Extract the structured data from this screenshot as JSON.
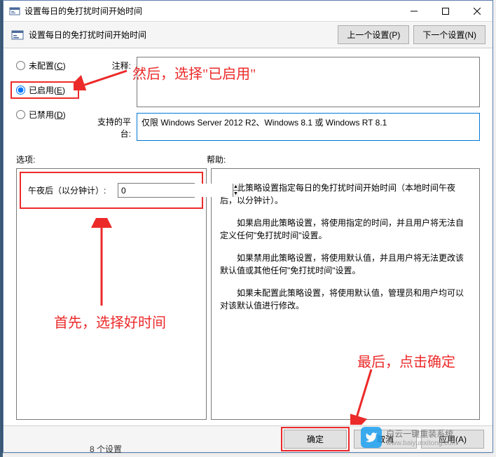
{
  "window": {
    "title": "设置每日的免打扰时间开始时间"
  },
  "toolbar": {
    "title": "设置每日的免打扰时间开始时间",
    "prev_button": "上一个设置(P)",
    "next_button": "下一个设置(N)"
  },
  "radios": {
    "not_configured": "未配置(C)",
    "enabled": "已启用(E)",
    "disabled": "已禁用(D)"
  },
  "fields": {
    "comment_label": "注释:",
    "comment_value": "",
    "platform_label": "支持的平台:",
    "platform_value": "仅限 Windows Server 2012 R2、Windows 8.1 或 Windows RT 8.1"
  },
  "section_labels": {
    "options": "选项:",
    "help": "帮助:"
  },
  "options": {
    "midnight_label": "午夜后（以分钟计）:",
    "midnight_value": "0"
  },
  "help": {
    "p1": "此策略设置指定每日的免打扰时间开始时间（本地时间午夜后，以分钟计）。",
    "p2": "如果启用此策略设置，将使用指定的时间，并且用户将无法自定义任何\"免打扰时间\"设置。",
    "p3": "如果禁用此策略设置，将使用默认值，并且用户将无法更改该默认值或其他任何\"免打扰时间\"设置。",
    "p4": "如果未配置此策略设置，将使用默认值，管理员和用户均可以对该默认值进行修改。"
  },
  "buttons": {
    "ok": "确定",
    "cancel": "取消",
    "apply": "应用(A)"
  },
  "annotations": {
    "a1": "然后，选择\"已启用\"",
    "a2": "首先，选择好时间",
    "a3": "最后，点击确定"
  },
  "watermark": "白云一键重装系统",
  "watermark_url": "www.baiyunxitong.com",
  "bottom_hint": "8 个设置"
}
